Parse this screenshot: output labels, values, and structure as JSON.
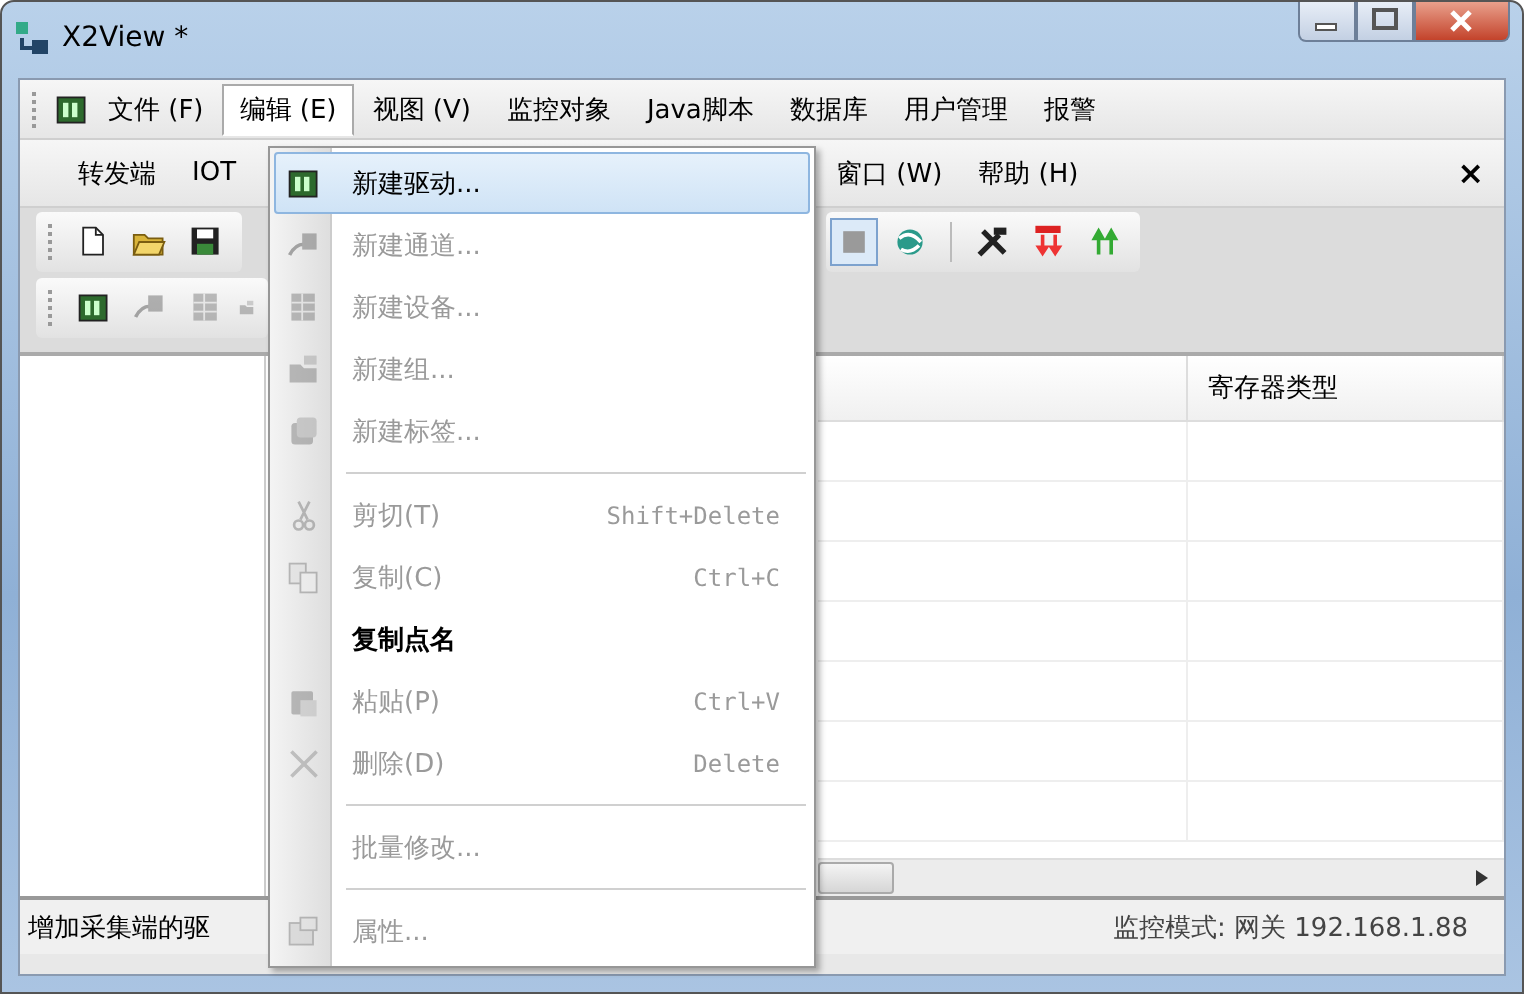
{
  "window": {
    "title": "X2View *"
  },
  "menu_bar": [
    {
      "label": "文件 (F)",
      "selected": false
    },
    {
      "label": "编辑 (E)",
      "selected": true
    },
    {
      "label": "视图 (V)",
      "selected": false
    },
    {
      "label": "监控对象",
      "selected": false
    },
    {
      "label": "Java脚本",
      "selected": false
    },
    {
      "label": "数据库",
      "selected": false
    },
    {
      "label": "用户管理",
      "selected": false
    },
    {
      "label": "报警",
      "selected": false
    }
  ],
  "second_menu_bar": {
    "items": [
      {
        "label": "转发端"
      },
      {
        "label": "IOT"
      },
      {
        "label": "窗口 (W)"
      },
      {
        "label": "帮助 (H)"
      }
    ],
    "close": "×"
  },
  "toolbar": [
    {
      "kind": "new",
      "selected": false
    },
    {
      "kind": "open",
      "selected": false
    },
    {
      "kind": "save",
      "selected": false
    },
    {
      "kind": "stop",
      "selected": true
    },
    {
      "kind": "connect",
      "selected": false
    },
    {
      "kind": "tools",
      "selected": false
    },
    {
      "kind": "load",
      "selected": false
    },
    {
      "kind": "upload",
      "selected": false
    }
  ],
  "object_toolbar": [
    {
      "kind": "driver",
      "disabled": false
    },
    {
      "kind": "channel",
      "disabled": true
    },
    {
      "kind": "device",
      "disabled": true
    },
    {
      "kind": "group",
      "disabled": true
    }
  ],
  "edit_menu": [
    {
      "kind": "item",
      "label": "新建驱动...",
      "disabled": false,
      "selected": true
    },
    {
      "kind": "item",
      "label": "新建通道...",
      "disabled": true,
      "selected": false
    },
    {
      "kind": "item",
      "label": "新建设备...",
      "disabled": true,
      "selected": false
    },
    {
      "kind": "item",
      "label": "新建组...",
      "disabled": true,
      "selected": false
    },
    {
      "kind": "item",
      "label": "新建标签...",
      "disabled": true,
      "selected": false
    },
    {
      "kind": "separator"
    },
    {
      "kind": "item",
      "label": "剪切(T)",
      "shortcut": "Shift+Delete",
      "disabled": true,
      "selected": false
    },
    {
      "kind": "item",
      "label": "复制(C)",
      "shortcut": "Ctrl+C",
      "disabled": true,
      "selected": false
    },
    {
      "kind": "item",
      "label": "复制点名",
      "disabled": false,
      "selected": false
    },
    {
      "kind": "item",
      "label": "粘贴(P)",
      "shortcut": "Ctrl+V",
      "disabled": true,
      "selected": false
    },
    {
      "kind": "item",
      "label": "删除(D)",
      "shortcut": "Delete",
      "disabled": true,
      "selected": false
    },
    {
      "kind": "separator"
    },
    {
      "kind": "item",
      "label": "批量修改...",
      "disabled": true,
      "selected": false
    },
    {
      "kind": "separator"
    },
    {
      "kind": "item",
      "label": "属性...",
      "disabled": true,
      "selected": false
    }
  ],
  "table": {
    "columns": [
      "寄存器类型"
    ]
  },
  "status_bar": {
    "hint": "增加采集端的驱",
    "mode": "监控模式: 网关 192.168.1.88"
  }
}
